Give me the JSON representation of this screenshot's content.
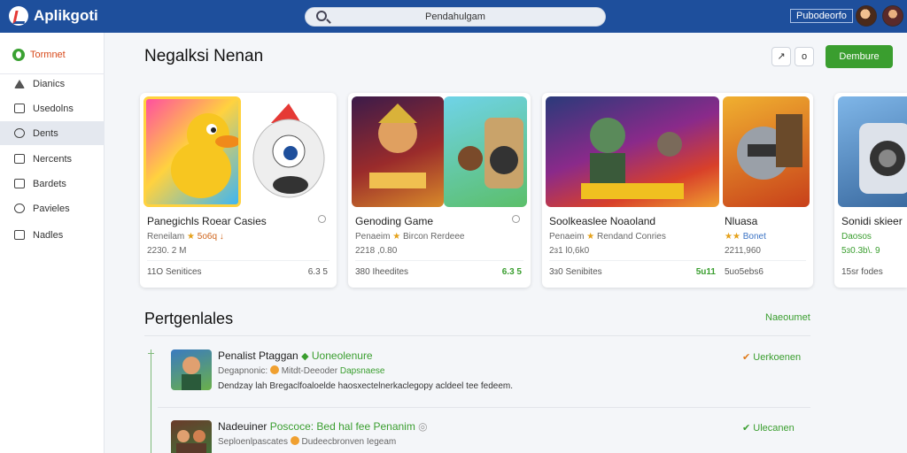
{
  "header": {
    "app_name": "Aplikgoti",
    "search_placeholder": "Pendahulgam",
    "top_button": "Pubodeorfo"
  },
  "sidebar": {
    "top_item": "Tormnet",
    "items": [
      {
        "label": "Dianics",
        "icon": "pin-icon"
      },
      {
        "label": "Usedolns",
        "icon": "bag-icon"
      },
      {
        "label": "Dents",
        "icon": "search-icon"
      },
      {
        "label": "Nercents",
        "icon": "monitor-icon"
      },
      {
        "label": "Bardets",
        "icon": "grid-icon"
      },
      {
        "label": "Pavieles",
        "icon": "circle-icon"
      },
      {
        "label": "Nadles",
        "icon": "app-icon"
      }
    ],
    "active_index": 2
  },
  "main": {
    "title": "Negalksi Nenan",
    "icon_button_1": "↗",
    "icon_button_2": "o",
    "primary_button": "Dembure",
    "cards": [
      {
        "name": "Panegichls Roear Casies",
        "meta_prefix": "Reneilam",
        "meta_rating": "5o6q ↓",
        "size": "2230. 2 M",
        "downloads": "11O Senitices",
        "rating": "6.3 5"
      },
      {
        "name": "Genoding Game",
        "meta_prefix": "Penaeim",
        "meta_rating": "Bircon Rerdeee",
        "size": "2218 ,0.80",
        "downloads": "380 Iheedites",
        "rating": "6.3 5"
      },
      {
        "name": "Soolkeaslee Noaoland",
        "meta_prefix": "Penaeim",
        "meta_rating": "Rendand Conries",
        "size": "2ɜ1 l0,6k0",
        "downloads": "3ɜ0 Senibites",
        "rating": "5u11"
      },
      {
        "name": "Nluasa",
        "meta_prefix": "",
        "meta_rating": "Bonet",
        "size": "2211,960",
        "downloads": "5uo5ebs6",
        "rating": ""
      },
      {
        "name": "Sonidi skieer",
        "meta_prefix": "Daosos",
        "meta_rating": "",
        "size": "5ɜ0.3b\\. 9",
        "downloads": "15sr fodes",
        "rating": ""
      }
    ]
  },
  "section": {
    "title": "Pertgenlales",
    "link": "Naeoumet",
    "rows": [
      {
        "title": "Penalist Ptaggan",
        "tag": "Uoneolenure",
        "subtitle_prefix": "Degapnonic:",
        "subtitle_mid": "Mitdt-Deeoder",
        "subtitle_green": "Dapsnaese",
        "description": "Dendzay lah Bregaclfoaloelde haosxectelnerkaclegopy acldeel tee fedeem.",
        "action": "Uerkoenen"
      },
      {
        "title": "Nadeuiner",
        "tag": "Poscoce: Bed hal fee Penanim",
        "subtitle_prefix": "Seploenlpascates",
        "subtitle_mid": "Dudeecbronven Iegeam",
        "subtitle_green": "",
        "description": "",
        "action": "Ulecanen"
      }
    ]
  },
  "colors": {
    "topbar": "#1e4f9c",
    "accent_green": "#3a9e2f",
    "accent_orange": "#d84a1b"
  }
}
